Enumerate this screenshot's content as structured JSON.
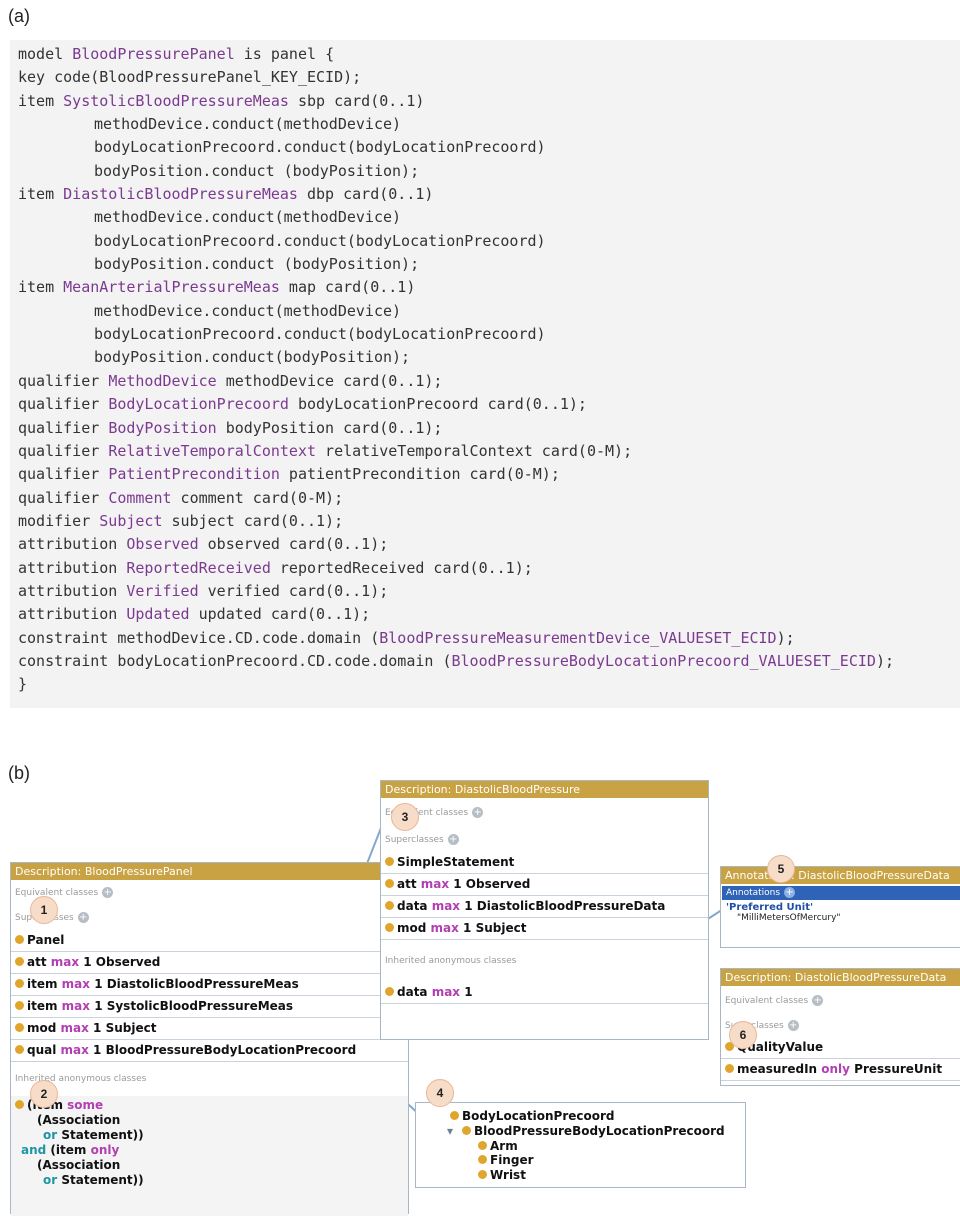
{
  "labels": {
    "a": "(a)",
    "b": "(b)"
  },
  "code_lines": [
    {
      "indent": false,
      "segments": [
        [
          "kw",
          "model "
        ],
        [
          "ty",
          "BloodPressurePanel"
        ],
        [
          "kw",
          " is panel "
        ],
        [
          "c",
          "{"
        ]
      ]
    },
    {
      "indent": false,
      "segments": [
        [
          "kw",
          "key code(BloodPressurePanel_KEY_ECID);"
        ]
      ]
    },
    {
      "indent": false,
      "segments": [
        [
          "kw",
          "item "
        ],
        [
          "ty",
          "SystolicBloodPressureMeas"
        ],
        [
          "kw",
          " sbp card(0..1)"
        ]
      ]
    },
    {
      "indent": true,
      "segments": [
        [
          "kw",
          "methodDevice.conduct(methodDevice)"
        ]
      ]
    },
    {
      "indent": true,
      "segments": [
        [
          "kw",
          "bodyLocationPrecoord.conduct(bodyLocationPrecoord)"
        ]
      ]
    },
    {
      "indent": true,
      "segments": [
        [
          "kw",
          "bodyPosition.conduct (bodyPosition);"
        ]
      ]
    },
    {
      "indent": false,
      "segments": [
        [
          "kw",
          "item "
        ],
        [
          "ty",
          "DiastolicBloodPressureMeas"
        ],
        [
          "kw",
          " dbp card(0..1)"
        ]
      ]
    },
    {
      "indent": true,
      "segments": [
        [
          "kw",
          "methodDevice.conduct(methodDevice)"
        ]
      ]
    },
    {
      "indent": true,
      "segments": [
        [
          "kw",
          "bodyLocationPrecoord.conduct(bodyLocationPrecoord)"
        ]
      ]
    },
    {
      "indent": true,
      "segments": [
        [
          "kw",
          "bodyPosition.conduct (bodyPosition);"
        ]
      ]
    },
    {
      "indent": false,
      "segments": [
        [
          "kw",
          "item "
        ],
        [
          "ty",
          "MeanArterialPressureMeas"
        ],
        [
          "kw",
          " map card(0..1)"
        ]
      ]
    },
    {
      "indent": true,
      "segments": [
        [
          "kw",
          "methodDevice.conduct(methodDevice)"
        ]
      ]
    },
    {
      "indent": true,
      "segments": [
        [
          "kw",
          "bodyLocationPrecoord.conduct(bodyLocationPrecoord)"
        ]
      ]
    },
    {
      "indent": true,
      "segments": [
        [
          "kw",
          "bodyPosition.conduct(bodyPosition);"
        ]
      ]
    },
    {
      "indent": false,
      "segments": [
        [
          "kw",
          "qualifier "
        ],
        [
          "ty",
          "MethodDevice"
        ],
        [
          "kw",
          " methodDevice card(0..1);"
        ]
      ]
    },
    {
      "indent": false,
      "segments": [
        [
          "kw",
          "qualifier "
        ],
        [
          "ty",
          "BodyLocationPrecoord"
        ],
        [
          "kw",
          " bodyLocationPrecoord card(0..1);"
        ]
      ]
    },
    {
      "indent": false,
      "segments": [
        [
          "kw",
          "qualifier "
        ],
        [
          "ty",
          "BodyPosition"
        ],
        [
          "kw",
          " bodyPosition card(0..1);"
        ]
      ]
    },
    {
      "indent": false,
      "segments": [
        [
          "kw",
          "qualifier "
        ],
        [
          "ty",
          "RelativeTemporalContext"
        ],
        [
          "kw",
          " relativeTemporalContext card(0-M);"
        ]
      ]
    },
    {
      "indent": false,
      "segments": [
        [
          "kw",
          "qualifier "
        ],
        [
          "ty",
          "PatientPrecondition"
        ],
        [
          "kw",
          " patientPrecondition card(0-M);"
        ]
      ]
    },
    {
      "indent": false,
      "segments": [
        [
          "kw",
          "qualifier "
        ],
        [
          "ty",
          "Comment"
        ],
        [
          "kw",
          " comment card(0-M);"
        ]
      ]
    },
    {
      "indent": false,
      "segments": [
        [
          "kw",
          "modifier "
        ],
        [
          "ty",
          "Subject"
        ],
        [
          "kw",
          " subject card(0..1);"
        ]
      ]
    },
    {
      "indent": false,
      "segments": [
        [
          "kw",
          "attribution "
        ],
        [
          "ty",
          "Observed"
        ],
        [
          "kw",
          " observed card(0..1);"
        ]
      ]
    },
    {
      "indent": false,
      "segments": [
        [
          "kw",
          "attribution "
        ],
        [
          "ty",
          "ReportedReceived"
        ],
        [
          "kw",
          " reportedReceived card(0..1);"
        ]
      ]
    },
    {
      "indent": false,
      "segments": [
        [
          "kw",
          "attribution "
        ],
        [
          "ty",
          "Verified"
        ],
        [
          "kw",
          " verified card(0..1);"
        ]
      ]
    },
    {
      "indent": false,
      "segments": [
        [
          "kw",
          "attribution "
        ],
        [
          "ty",
          "Updated"
        ],
        [
          "kw",
          " updated card(0..1);"
        ]
      ]
    },
    {
      "indent": false,
      "segments": [
        [
          "kw",
          "constraint methodDevice.CD.code.domain ("
        ],
        [
          "ty",
          "BloodPressureMeasurementDevice_VALUESET_ECID"
        ],
        [
          "kw",
          ");"
        ]
      ]
    },
    {
      "indent": false,
      "segments": [
        [
          "kw",
          "constraint bodyLocationPrecoord.CD.code.domain ("
        ],
        [
          "ty",
          "BloodPressureBodyLocationPrecoord_VALUESET_ECID"
        ],
        [
          "kw",
          ");"
        ]
      ]
    },
    {
      "indent": false,
      "segments": [
        [
          "c",
          "}"
        ]
      ]
    }
  ],
  "panel1": {
    "header": "Description: BloodPressurePanel",
    "equivalent_label": "Equivalent classes",
    "superclasses_label": "Superclasses",
    "rows": [
      [
        [
          "n",
          "Panel"
        ]
      ],
      [
        [
          "n",
          "att "
        ],
        [
          "m",
          "max"
        ],
        [
          "n",
          " 1 Observed"
        ]
      ],
      [
        [
          "n",
          "item "
        ],
        [
          "m",
          "max"
        ],
        [
          "n",
          " 1 DiastolicBloodPressureMeas"
        ]
      ],
      [
        [
          "n",
          "item "
        ],
        [
          "m",
          "max"
        ],
        [
          "n",
          " 1 SystolicBloodPressureMeas"
        ]
      ],
      [
        [
          "n",
          "mod "
        ],
        [
          "m",
          "max"
        ],
        [
          "n",
          " 1 Subject"
        ]
      ],
      [
        [
          "n",
          "qual "
        ],
        [
          "m",
          "max"
        ],
        [
          "n",
          " 1 BloodPressureBodyLocationPrecoord"
        ]
      ]
    ],
    "inherited_label": "Inherited anonymous classes",
    "anon_lines": [
      [
        [
          "n",
          "(item "
        ],
        [
          "m",
          "some"
        ]
      ],
      [
        [
          "n",
          "(Association"
        ]
      ],
      [
        [
          "c",
          "or"
        ],
        [
          "n",
          " Statement))"
        ]
      ],
      [
        [
          "c",
          "and"
        ],
        [
          "n",
          " (item "
        ],
        [
          "m",
          "only"
        ]
      ],
      [
        [
          "n",
          "(Association"
        ]
      ],
      [
        [
          "c",
          "or"
        ],
        [
          "n",
          " Statement))"
        ]
      ]
    ]
  },
  "panel3": {
    "header": "Description: DiastolicBloodPressure",
    "equivalent_label": "Equivalent classes",
    "superclasses_label": "Superclasses",
    "rows": [
      [
        [
          "n",
          "SimpleStatement"
        ]
      ],
      [
        [
          "n",
          "att "
        ],
        [
          "m",
          "max"
        ],
        [
          "n",
          " 1 Observed"
        ]
      ],
      [
        [
          "n",
          "data "
        ],
        [
          "m",
          "max"
        ],
        [
          "n",
          " 1 DiastolicBloodPressureData"
        ]
      ],
      [
        [
          "n",
          "mod "
        ],
        [
          "m",
          "max"
        ],
        [
          "n",
          " 1 Subject"
        ]
      ]
    ],
    "inherited_label": "Inherited anonymous classes",
    "inherited_rows": [
      [
        [
          "n",
          "data "
        ],
        [
          "m",
          "max"
        ],
        [
          "n",
          " 1"
        ]
      ]
    ]
  },
  "panel4": {
    "rows": [
      {
        "arrow": false,
        "dot": true,
        "text": "BodyLocationPrecoord"
      },
      {
        "arrow": true,
        "dot": true,
        "text": "BloodPressureBodyLocationPrecoord"
      },
      {
        "arrow": false,
        "dot": true,
        "text": "Arm"
      },
      {
        "arrow": false,
        "dot": true,
        "text": "Finger"
      },
      {
        "arrow": false,
        "dot": true,
        "text": "Wrist"
      }
    ]
  },
  "panel5": {
    "header": "Annotations: DiastolicBloodPressureData",
    "annotations_label": "Annotations",
    "property": "'Preferred Unit'",
    "value": "\"MilliMetersOfMercury\""
  },
  "panel6": {
    "header": "Description: DiastolicBloodPressureData",
    "equivalent_label": "Equivalent classes",
    "superclasses_label": "Superclasses",
    "rows": [
      [
        [
          "n",
          "QualityValue"
        ]
      ],
      [
        [
          "n",
          "measuredIn "
        ],
        [
          "m",
          "only"
        ],
        [
          "n",
          " PressureUnit"
        ]
      ]
    ]
  },
  "callouts": [
    "1",
    "2",
    "3",
    "4",
    "5",
    "6"
  ]
}
